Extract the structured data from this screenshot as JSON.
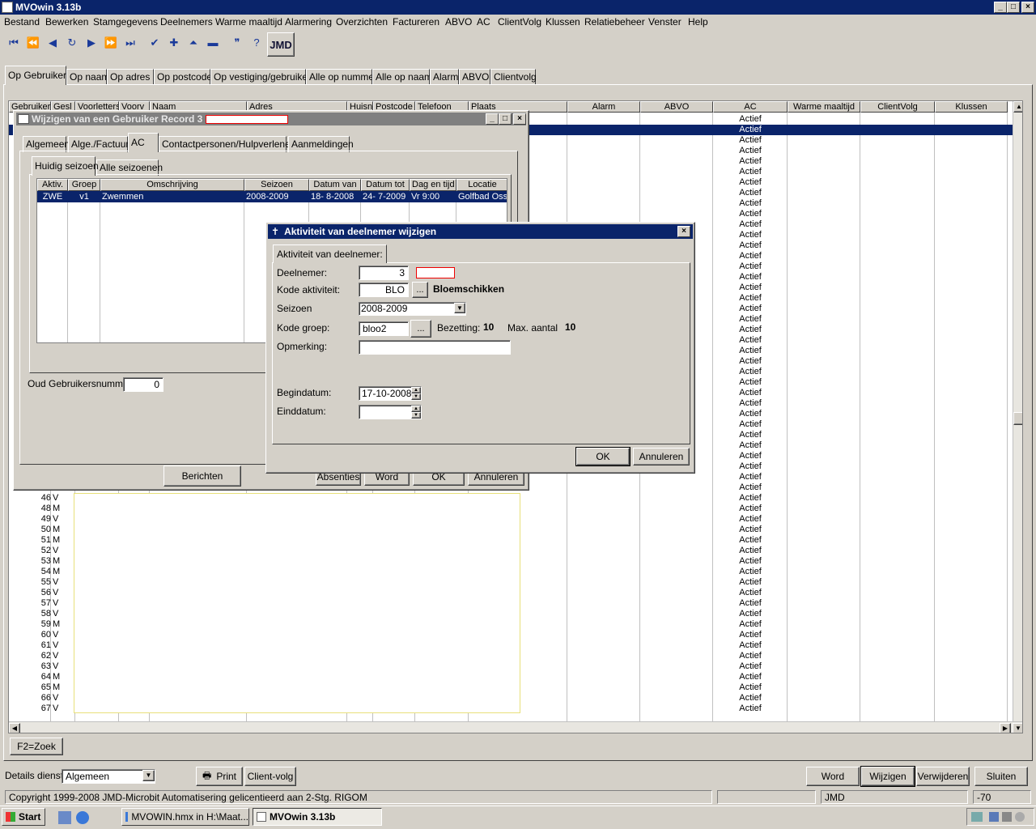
{
  "app": {
    "title": "MVOwin 3.13b",
    "window_controls": [
      "_",
      "□",
      "×"
    ]
  },
  "menu": [
    "Bestand",
    "Bewerken",
    "Stamgegevens",
    "Deelnemers",
    "Warme maaltijd",
    "Alarmering",
    "Overzichten",
    "Factureren",
    "ABVO",
    "AC",
    "ClientVolg",
    "Klussen",
    "Relatiebeheer",
    "Venster",
    "Help"
  ],
  "toolbar": {
    "logo_text": "JMD",
    "tools": [
      "first-icon",
      "prev-page-icon",
      "prev-icon",
      "refresh-icon",
      "next-icon",
      "next-page-icon",
      "last-icon",
      "check-icon",
      "plus-icon",
      "up-icon",
      "minus-icon",
      "quote-icon",
      "help-icon"
    ]
  },
  "main_tabs": [
    "Op Gebruiker",
    "Op naam",
    "Op  adres",
    "Op postcode",
    "Op vestiging/gebruiker",
    "Alle op nummer",
    "Alle op naam",
    "Alarm",
    "ABVO",
    "Clientvolg"
  ],
  "grid": {
    "headers": [
      "Gebruiker",
      "Gesl",
      "Voorletters",
      "Voorv",
      "Naam",
      "Adres",
      "Huisn",
      "Postcode",
      "Telefoon",
      "Plaats",
      "Alarm",
      "ABVO",
      "AC",
      "Warme maaltijd",
      "ClientVolg",
      "Klussen"
    ],
    "ac_value": "Actief",
    "rows": [
      {
        "nr": "46",
        "g": "V"
      },
      {
        "nr": "48",
        "g": "M"
      },
      {
        "nr": "49",
        "g": "V"
      },
      {
        "nr": "50",
        "g": "M"
      },
      {
        "nr": "51",
        "g": "M"
      },
      {
        "nr": "52",
        "g": "V"
      },
      {
        "nr": "53",
        "g": "M"
      },
      {
        "nr": "54",
        "g": "M"
      },
      {
        "nr": "55",
        "g": "V"
      },
      {
        "nr": "56",
        "g": "V"
      },
      {
        "nr": "57",
        "g": "V"
      },
      {
        "nr": "58",
        "g": "V"
      },
      {
        "nr": "59",
        "g": "M"
      },
      {
        "nr": "60",
        "g": "V"
      },
      {
        "nr": "61",
        "g": "V"
      },
      {
        "nr": "62",
        "g": "V"
      },
      {
        "nr": "63",
        "g": "V"
      },
      {
        "nr": "64",
        "g": "M"
      },
      {
        "nr": "65",
        "g": "M"
      },
      {
        "nr": "66",
        "g": "V"
      },
      {
        "nr": "67",
        "g": "V"
      }
    ]
  },
  "search_button": "F2=Zoek",
  "bottom_bar": {
    "details_label": "Details dienst:",
    "details_value": "Algemeen",
    "print": "Print",
    "client_volg": "Client-volg",
    "word": "Word",
    "wijzigen": "Wijzigen",
    "verwijderen": "Verwijderen",
    "sluiten": "Sluiten"
  },
  "status": {
    "copyright": "Copyright 1999-2008 JMD-Microbit Automatisering gelicentieerd aan 2-Stg. RIGOM",
    "user": "JMD",
    "value": "-70"
  },
  "taskbar": {
    "start": "Start",
    "items": [
      "MVOWIN.hmx in H:\\Maat...",
      "MVOwin 3.13b"
    ]
  },
  "user_window": {
    "title": "Wijzigen van een Gebruiker Record 3",
    "tabs": [
      "Algemeen",
      "Alge./Factuur",
      "AC",
      "Contactpersonen/Hulpverleners",
      "Aanmeldingen"
    ],
    "subtabs": [
      "Huidig seizoen",
      "Alle seizoenen"
    ],
    "table_headers": [
      "Aktiv.",
      "Groep",
      "Omschrijving",
      "Seizoen",
      "Datum van",
      "Datum tot",
      "Dag en tijd",
      "Locatie"
    ],
    "row": [
      "ZWE",
      "v1",
      "Zwemmen",
      "2008-2009",
      "18- 8-2008",
      "24- 7-2009",
      "Vr  9:00",
      "Golfbad Oss"
    ],
    "oud_label": "Oud Gebruikersnummer:",
    "oud_value": "0",
    "buttons": [
      "Berichten",
      "Absenties",
      "Word",
      "OK",
      "Annuleren"
    ]
  },
  "dialog": {
    "title": "Aktiviteit van deelnemer wijzigen",
    "tab": "Aktiviteit van deelnemer:",
    "deelnemer_label": "Deelnemer:",
    "deelnemer_value": "3",
    "kode_label": "Kode aktiviteit:",
    "kode_value": "BLO",
    "kode_desc": "Bloemschikken",
    "seizoen_label": "Seizoen",
    "seizoen_value": "2008-2009",
    "groep_label": "Kode groep:",
    "groep_value": "bloo2",
    "bezetting_label": "Bezetting:",
    "bezetting_value": "10",
    "max_label": "Max. aantal",
    "max_value": "10",
    "opmerking_label": "Opmerking:",
    "opmerking_value": "",
    "begin_label": "Begindatum:",
    "begin_value": "17-10-2008",
    "eind_label": "Einddatum:",
    "eind_value": "",
    "ellipsis": "...",
    "ok": "OK",
    "annuleren": "Annuleren"
  }
}
